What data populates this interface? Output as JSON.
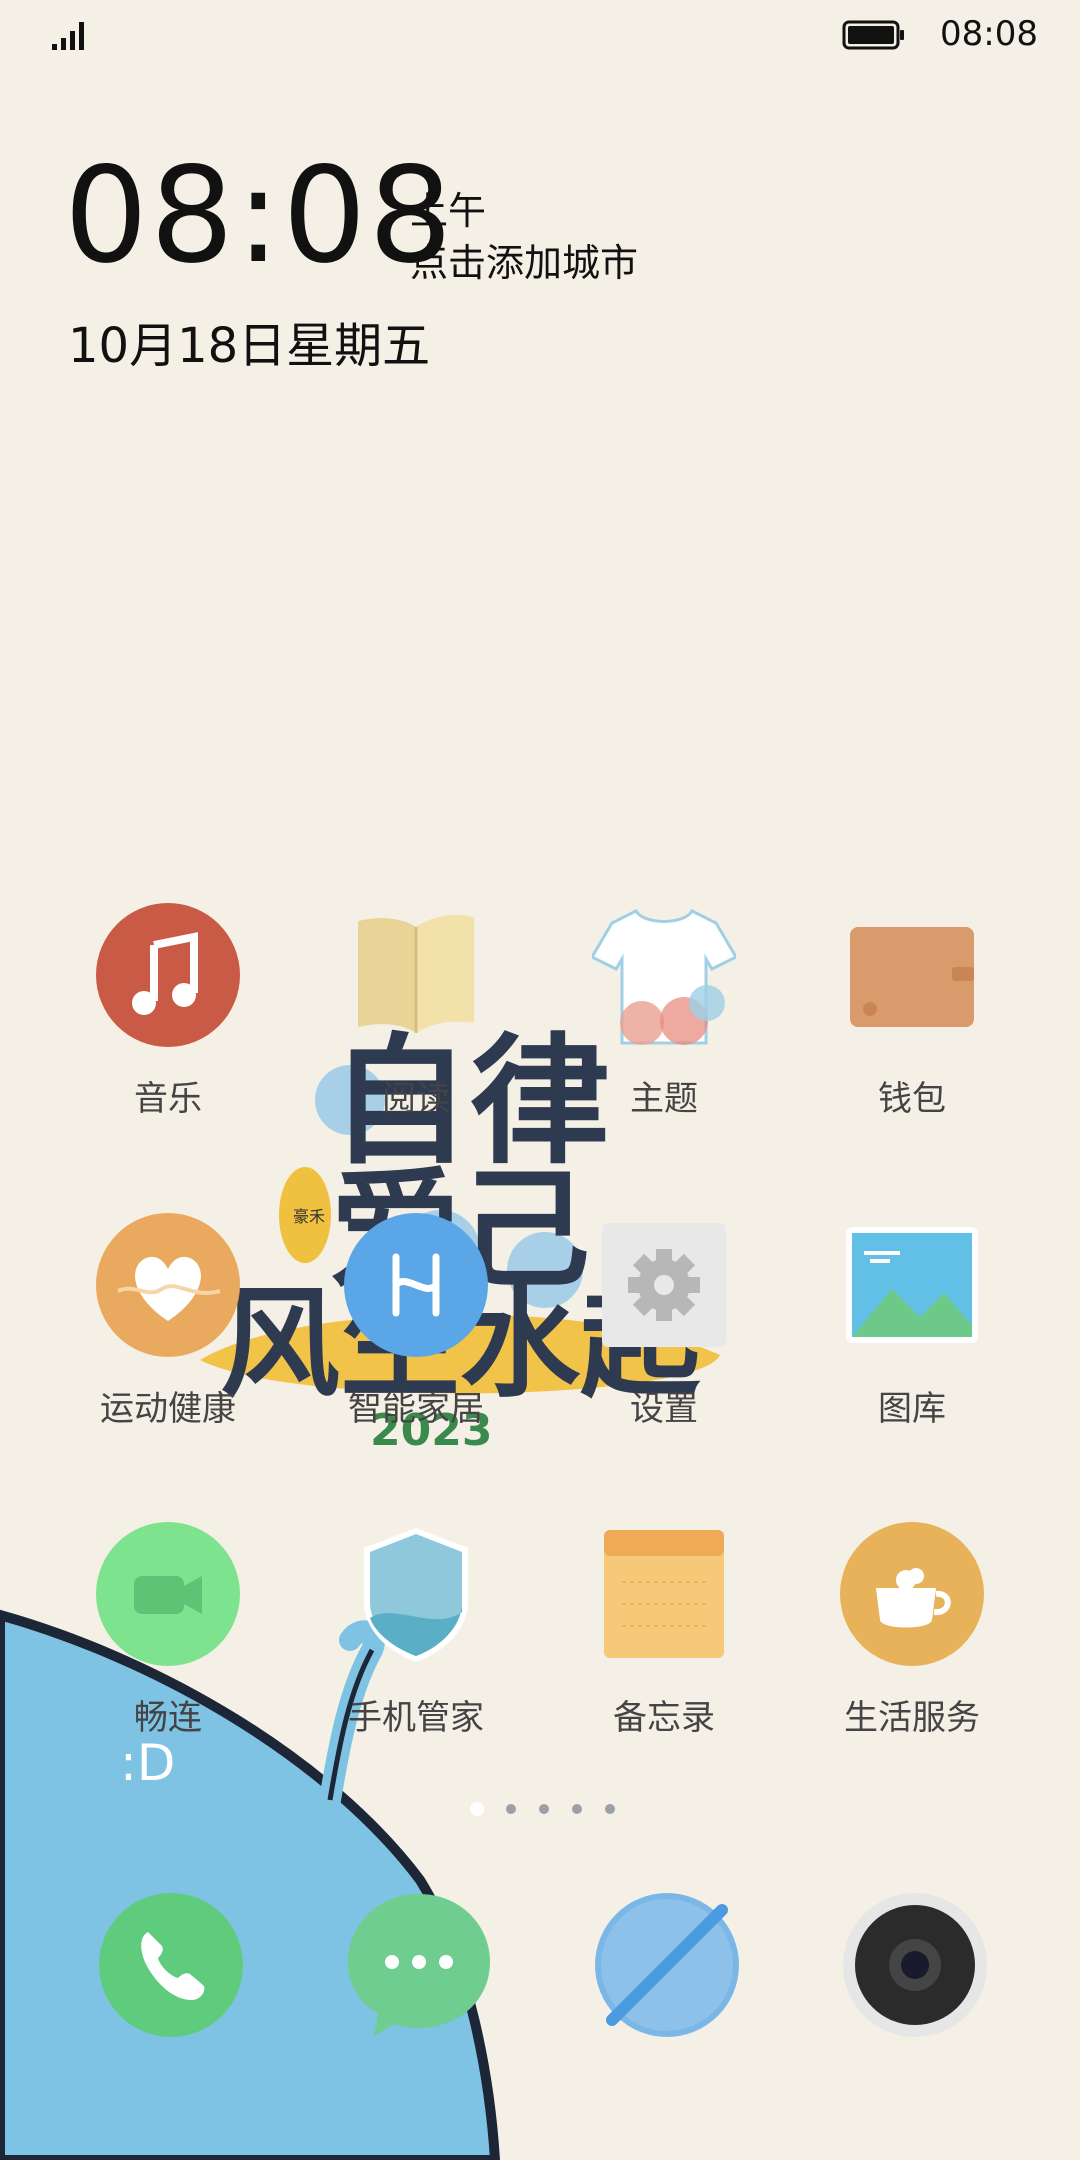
{
  "status_bar": {
    "time": "08:08",
    "signal_icon": "signal-icon",
    "battery_icon": "battery-icon"
  },
  "clock_widget": {
    "time": "08:08",
    "am_pm": "上午",
    "city_prompt": "点击添加城市",
    "date": "10月18日星期五"
  },
  "apps": [
    {
      "label": "音乐",
      "icon": "music-icon",
      "color": "#c95a45"
    },
    {
      "label": "阅读",
      "icon": "book-icon",
      "color": "#efdca6"
    },
    {
      "label": "主题",
      "icon": "tshirt-icon",
      "color": "#ffffff"
    },
    {
      "label": "钱包",
      "icon": "wallet-icon",
      "color": "#d99a6c"
    },
    {
      "label": "运动健康",
      "icon": "heart-icon",
      "color": "#e9a95e"
    },
    {
      "label": "智能家居",
      "icon": "smart-home-icon",
      "color": "#5aa6e6"
    },
    {
      "label": "设置",
      "icon": "gear-icon",
      "color": "#e8e8e8"
    },
    {
      "label": "图库",
      "icon": "gallery-icon",
      "color": "#62c0e6"
    },
    {
      "label": "畅连",
      "icon": "video-call-icon",
      "color": "#7ee38f"
    },
    {
      "label": "手机管家",
      "icon": "shield-icon",
      "color": "#73b9cf"
    },
    {
      "label": "备忘录",
      "icon": "notepad-icon",
      "color": "#f5c978"
    },
    {
      "label": "生活服务",
      "icon": "coffee-icon",
      "color": "#e8b25a"
    }
  ],
  "page_indicator": {
    "pages": 5,
    "active": 1
  },
  "dock": [
    {
      "name": "phone",
      "icon": "phone-icon",
      "color": "#5fcb7c"
    },
    {
      "name": "messages",
      "icon": "message-icon",
      "color": "#6fcd8f"
    },
    {
      "name": "browser",
      "icon": "browser-icon",
      "color": "#7bb7e6"
    },
    {
      "name": "camera",
      "icon": "camera-icon",
      "color": "#2b2b2b"
    }
  ],
  "wallpaper": {
    "text_line1": "自律",
    "text_line2": "爱己",
    "text_line3": "风生水起",
    "year": "2023",
    "badge_text": "豪禾"
  }
}
